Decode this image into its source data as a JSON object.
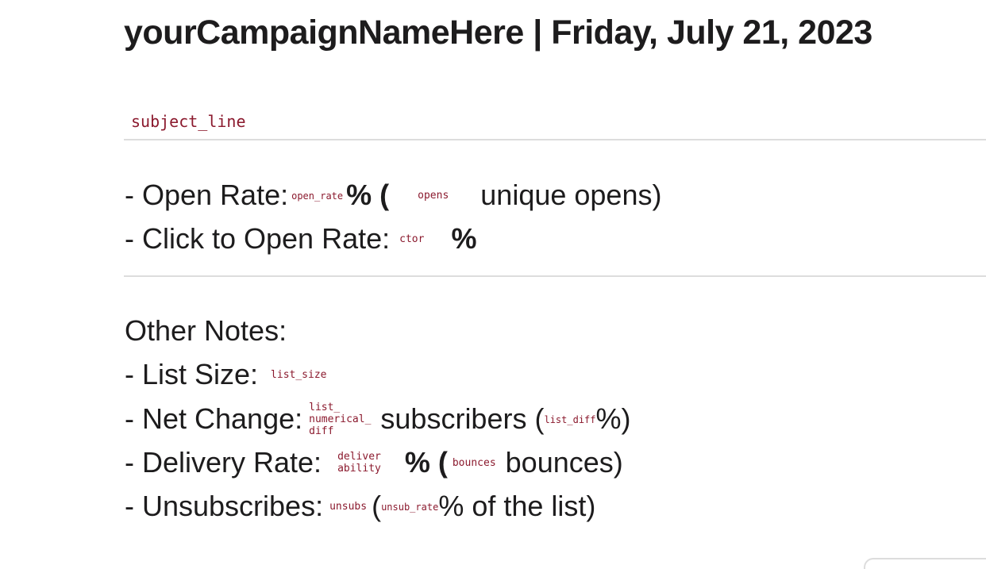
{
  "header": {
    "title": "yourCampaignNameHere | Friday, July 21, 2023"
  },
  "subject": {
    "token": "subject_line"
  },
  "metrics": {
    "open_rate_label": "- Open Rate:",
    "open_rate_token": "open_rate",
    "percent_paren": "% (",
    "opens_token": "opens",
    "unique_opens_suffix": "unique opens)",
    "ctor_label": "- Click to Open Rate:",
    "ctor_token": "ctor",
    "percent": "%"
  },
  "notes": {
    "heading": "Other Notes:",
    "list_size_label": "- List Size:",
    "list_size_token": "list_size",
    "net_change_label": "- Net Change:",
    "net_change_token_line1": "list_",
    "net_change_token_line2": "numerical_",
    "net_change_token_line3": "diff",
    "subscribers_text": "subscribers (",
    "list_diff_token": "list_diff",
    "percent_close": "%)",
    "delivery_label": "- Delivery Rate:",
    "deliverability_line1": "deliver",
    "deliverability_line2": "ability",
    "percent_paren": "% (",
    "bounces_token": "bounces",
    "bounces_suffix": "bounces)",
    "unsubs_label": "- Unsubscribes:",
    "unsubs_token": "unsubs",
    "open_paren": "(",
    "unsub_rate_token": "unsub_rate",
    "of_list_suffix": "% of the list)"
  },
  "colors": {
    "token": "#8b1a2e",
    "text": "#1d1c1d",
    "divider": "#dddddd"
  }
}
